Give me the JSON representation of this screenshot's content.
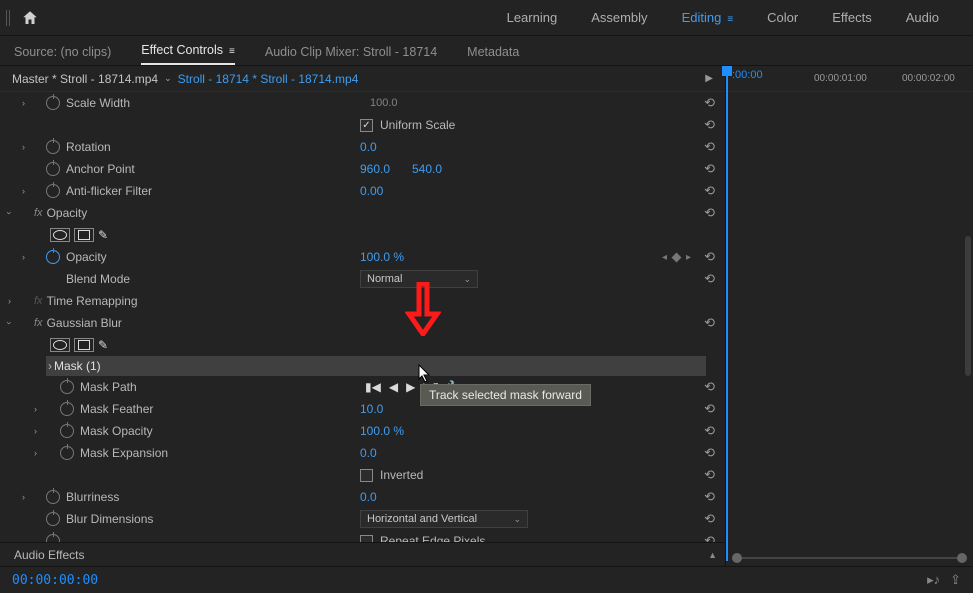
{
  "workspaces": {
    "learning": "Learning",
    "assembly": "Assembly",
    "editing": "Editing",
    "color": "Color",
    "effects": "Effects",
    "audio": "Audio"
  },
  "panel_tabs": {
    "source": "Source: (no clips)",
    "effect_controls": "Effect Controls",
    "audio_mixer": "Audio Clip Mixer: Stroll - 18714",
    "metadata": "Metadata"
  },
  "clip": {
    "master": "Master * Stroll - 18714.mp4",
    "sequence": "Stroll - 18714 * Stroll - 18714.mp4"
  },
  "props": {
    "scale_width": {
      "label": "Scale Width",
      "value": "100.0"
    },
    "uniform_scale": {
      "label": "Uniform Scale"
    },
    "rotation": {
      "label": "Rotation",
      "value": "0.0"
    },
    "anchor_point": {
      "label": "Anchor Point",
      "x": "960.0",
      "y": "540.0"
    },
    "anti_flicker": {
      "label": "Anti-flicker Filter",
      "value": "0.00"
    },
    "opacity_group": "Opacity",
    "opacity": {
      "label": "Opacity",
      "value": "100.0 %"
    },
    "blend_mode": {
      "label": "Blend Mode",
      "value": "Normal"
    },
    "time_remapping": "Time Remapping",
    "gaussian_blur": "Gaussian Blur",
    "mask1": "Mask (1)",
    "mask_path": {
      "label": "Mask Path"
    },
    "mask_feather": {
      "label": "Mask Feather",
      "value": "10.0"
    },
    "mask_opacity": {
      "label": "Mask Opacity",
      "value": "100.0 %"
    },
    "mask_expansion": {
      "label": "Mask Expansion",
      "value": "0.0"
    },
    "inverted": "Inverted",
    "blurriness": {
      "label": "Blurriness",
      "value": "0.0"
    },
    "blur_dimensions": {
      "label": "Blur Dimensions",
      "value": "Horizontal and Vertical"
    },
    "repeat_edge": "Repeat Edge Pixels"
  },
  "audio_effects": "Audio Effects",
  "timecode": "00:00:00:00",
  "timeline_ticks": {
    "t0": ":00:00",
    "t1": "00:00:01:00",
    "t2": "00:00:02:00"
  },
  "tooltip": "Track selected mask forward"
}
